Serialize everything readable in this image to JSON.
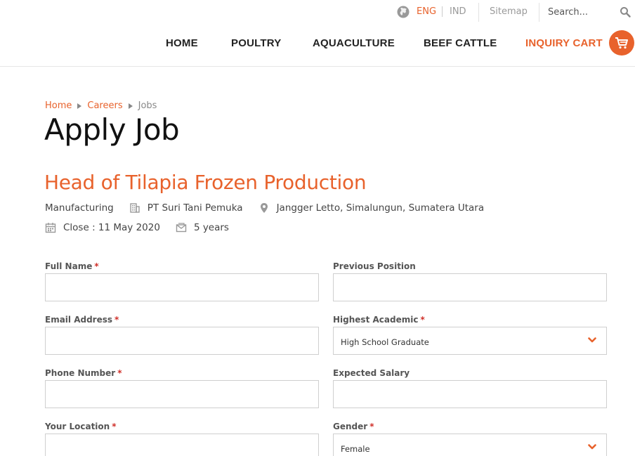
{
  "topbar": {
    "lang_eng": "ENG",
    "lang_ind": "IND",
    "sitemap": "Sitemap",
    "search_placeholder": "Search..."
  },
  "nav": {
    "home": "HOME",
    "poultry": "POULTRY",
    "aquaculture": "AQUACULTURE",
    "beef_cattle": "BEEF CATTLE",
    "inquiry_cart": "INQUIRY CART"
  },
  "breadcrumb": {
    "items": [
      "Home",
      "Careers",
      "Jobs"
    ]
  },
  "page": {
    "title": "Apply Job"
  },
  "job": {
    "title": "Head of Tilapia Frozen Production",
    "department": "Manufacturing",
    "company": "PT Suri Tani Pemuka",
    "location": "Jangger Letto, Simalungun, Sumatera Utara",
    "close": "Close : 11 May 2020",
    "experience": "5 years"
  },
  "form": {
    "required_mark": "*",
    "full_name": {
      "label": "Full Name",
      "value": ""
    },
    "previous_position": {
      "label": "Previous Position",
      "value": ""
    },
    "email": {
      "label": "Email Address",
      "value": ""
    },
    "highest_academic": {
      "label": "Highest Academic",
      "selected": "High School Graduate"
    },
    "phone": {
      "label": "Phone Number",
      "value": ""
    },
    "expected_salary": {
      "label": "Expected Salary",
      "value": ""
    },
    "location": {
      "label": "Your Location",
      "value": ""
    },
    "gender": {
      "label": "Gender",
      "selected": "Female"
    }
  },
  "colors": {
    "accent": "#e8622c",
    "required": "#d0302a",
    "text": "#333333"
  },
  "icons": {
    "globe": "globe-icon",
    "search": "search-icon",
    "cart": "cart-icon",
    "building": "building-icon",
    "location": "map-pin-icon",
    "calendar": "calendar-icon",
    "experience": "envelope-icon",
    "chevron": "chevron-down-icon"
  }
}
